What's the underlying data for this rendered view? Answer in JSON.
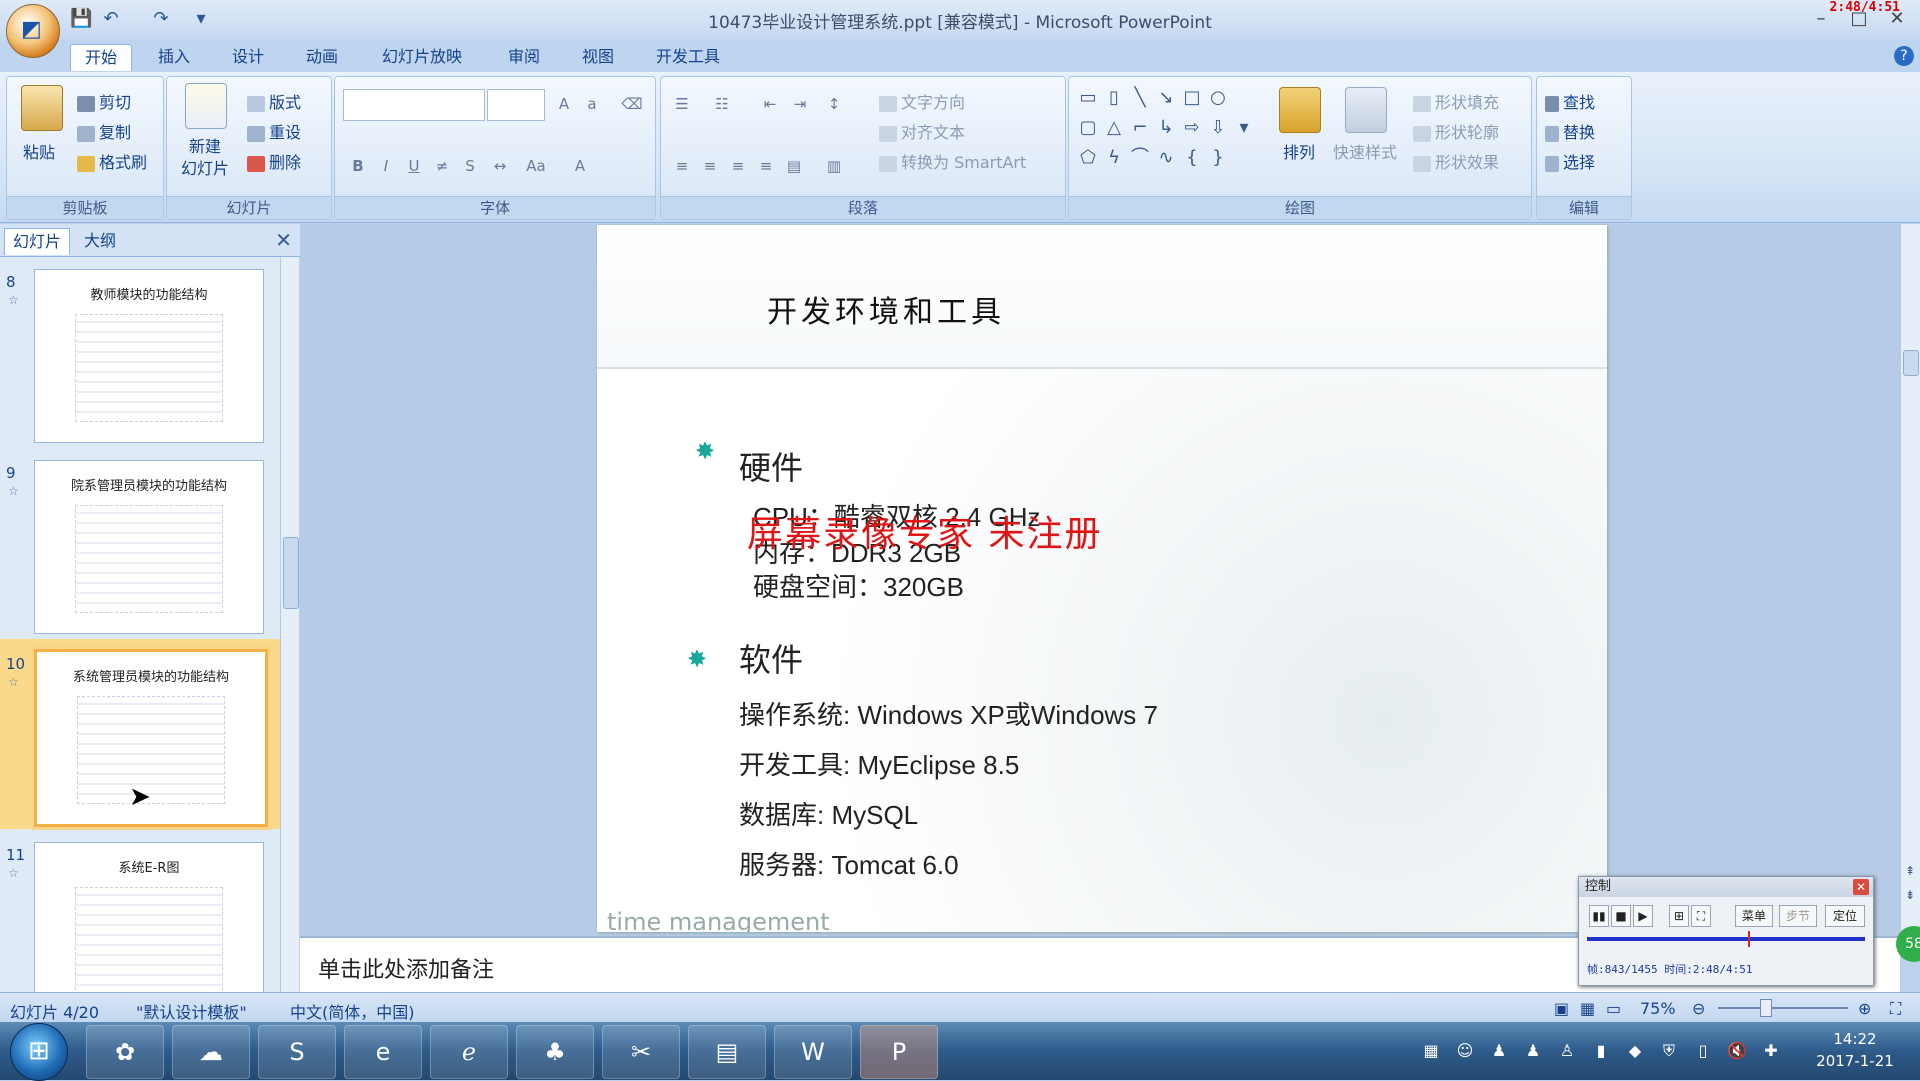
{
  "window": {
    "title": "10473毕业设计管理系统.ppt [兼容模式] - Microsoft PowerPoint",
    "overlay_timer": "2:48/4:51",
    "controls": [
      "–",
      "□",
      "✕"
    ]
  },
  "quick_access": {
    "save": "💾",
    "undo": "↶",
    "redo": "↷",
    "more": "▾"
  },
  "ribbon_tabs": [
    "开始",
    "插入",
    "设计",
    "动画",
    "幻灯片放映",
    "审阅",
    "视图",
    "开发工具"
  ],
  "active_tab": "开始",
  "ribbon": {
    "clipboard": {
      "paste": "粘贴",
      "cut": "剪切",
      "copy": "复制",
      "format_painter": "格式刷",
      "label": "剪贴板"
    },
    "slides": {
      "new_slide_line1": "新建",
      "new_slide_line2": "幻灯片",
      "layout": "版式",
      "reset": "重设",
      "delete": "删除",
      "label": "幻灯片"
    },
    "font": {
      "label": "字体"
    },
    "paragraph": {
      "text_direction": "文字方向",
      "align_text": "对齐文本",
      "convert_smartart": "转换为 SmartArt",
      "label": "段落"
    },
    "drawing": {
      "arrange": "排列",
      "quick_styles": "快速样式",
      "shape_fill": "形状填充",
      "shape_outline": "形状轮廓",
      "shape_effects": "形状效果",
      "label": "绘图"
    },
    "editing": {
      "find": "查找",
      "replace": "替换",
      "select": "选择",
      "label": "编辑"
    }
  },
  "left_pane": {
    "tabs": [
      "幻灯片",
      "大纲"
    ],
    "close": "✕",
    "thumbnails": [
      {
        "number": "8",
        "title": "教师模块的功能结构",
        "selected": false
      },
      {
        "number": "9",
        "title": "院系管理员模块的功能结构",
        "selected": false
      },
      {
        "number": "10",
        "title": "系统管理员模块的功能结构",
        "selected": true
      },
      {
        "number": "11",
        "title": "系统E-R图",
        "selected": false
      }
    ]
  },
  "slide": {
    "title": "开发环境和工具",
    "sections": [
      {
        "heading": "硬件",
        "items": [
          "CPU：酷睿双核 2.4 GHz",
          "内存：DDR3 2GB",
          "硬盘空间：320GB"
        ]
      },
      {
        "heading": "软件",
        "items": [
          "操作系统: Windows XP或Windows 7",
          "开发工具: MyEclipse 8.5",
          "数据库: MySQL",
          "服务器: Tomcat 6.0"
        ]
      }
    ],
    "watermark": "屏幕录像专家  未注册",
    "footer_text": "time management"
  },
  "notes": {
    "placeholder": "单击此处添加备注"
  },
  "recorder": {
    "title": "控制",
    "buttons": [
      "菜单",
      "步节",
      "定位"
    ],
    "progress": 0.58,
    "info": "帧:843/1455 时间:2:48/4:51",
    "badge": "58"
  },
  "status": {
    "slide_info": "幻灯片 4/20",
    "theme": "\"默认设计模板\"",
    "language": "中文(简体，中国)",
    "zoom": "75%"
  },
  "taskbar": {
    "clock_time": "14:22",
    "clock_date": "2017-1-21"
  }
}
